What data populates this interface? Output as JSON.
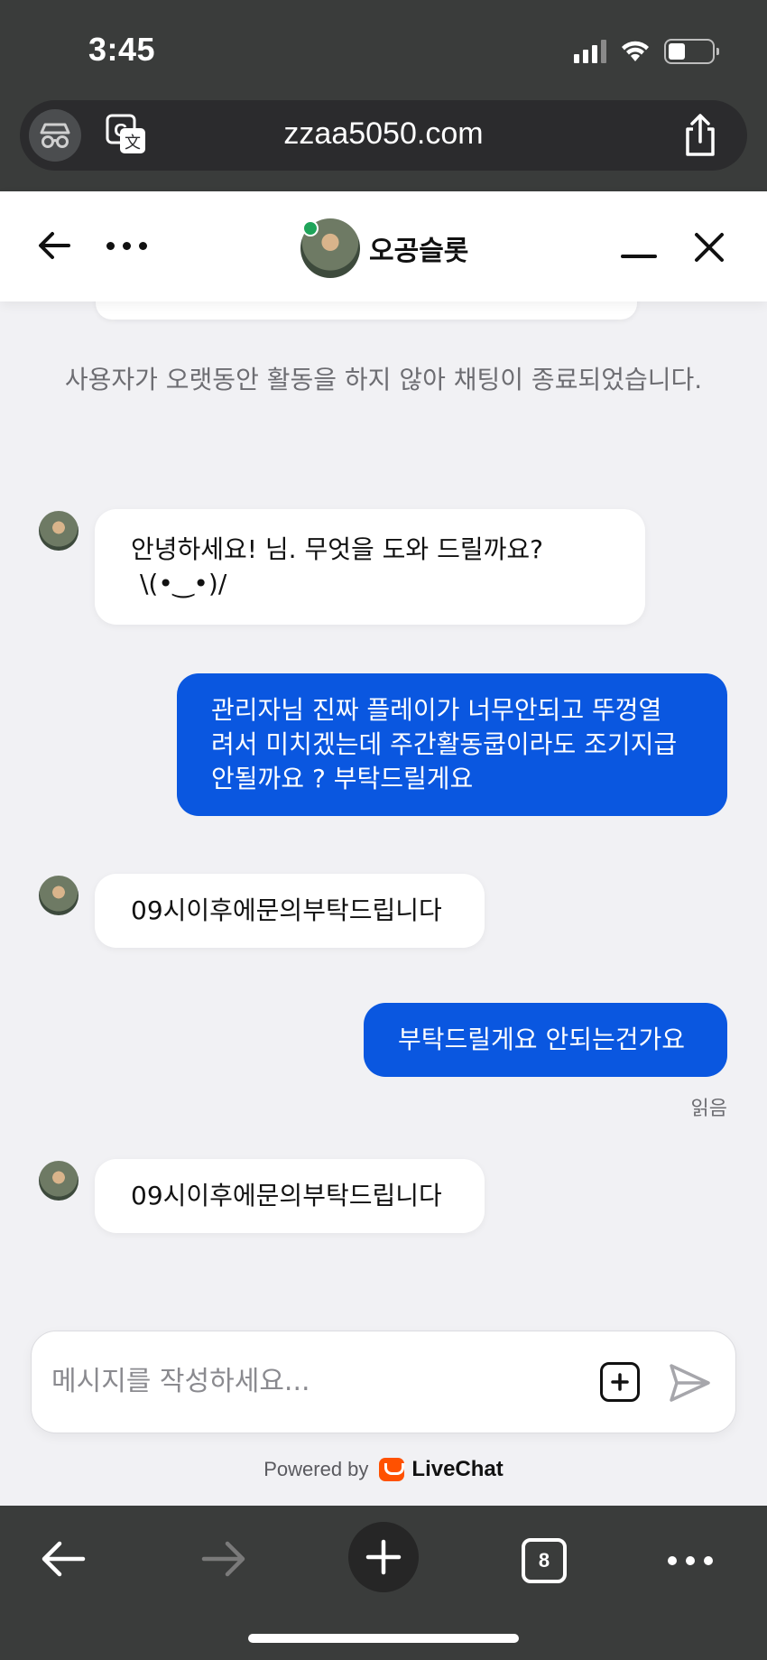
{
  "status_bar": {
    "time": "3:45"
  },
  "browser": {
    "url": "zzaa5050.com",
    "tab_count": "8"
  },
  "chat_header": {
    "agent_name": "오공슬롯",
    "agent_online": true
  },
  "system_message": "사용자가 오랫동안 활동을 하지 않아 채팅이 종료되었습니다.",
  "messages": [
    {
      "from": "agent",
      "lines": [
        "안녕하세요! 님. 무엇을 도와 드릴까요?",
        "\\(•‿•)/"
      ]
    },
    {
      "from": "user",
      "lines": [
        "관리자님 진짜 플레이가 너무안되고 뚜껑열",
        "려서 미치겠는데 주간활동쿱이라도 조기지급",
        "안될까요 ? 부탁드릴게요"
      ]
    },
    {
      "from": "agent",
      "lines": [
        "09시이후에문의부탁드립니다"
      ]
    },
    {
      "from": "user",
      "lines": [
        "부탁드릴게요 안되는건가요"
      ],
      "status": "읽음"
    },
    {
      "from": "agent",
      "lines": [
        "09시이후에문의부탁드립니다"
      ]
    }
  ],
  "composer": {
    "placeholder": "메시지를 작성하세요..."
  },
  "footer": {
    "powered_by": "Powered by",
    "brand": "LiveChat"
  },
  "colors": {
    "user_bubble": "#0a57e0",
    "agent_bubble": "#ffffff",
    "chat_bg": "#f1f1f4",
    "online": "#1fa45a",
    "brand": "#ff5100"
  }
}
